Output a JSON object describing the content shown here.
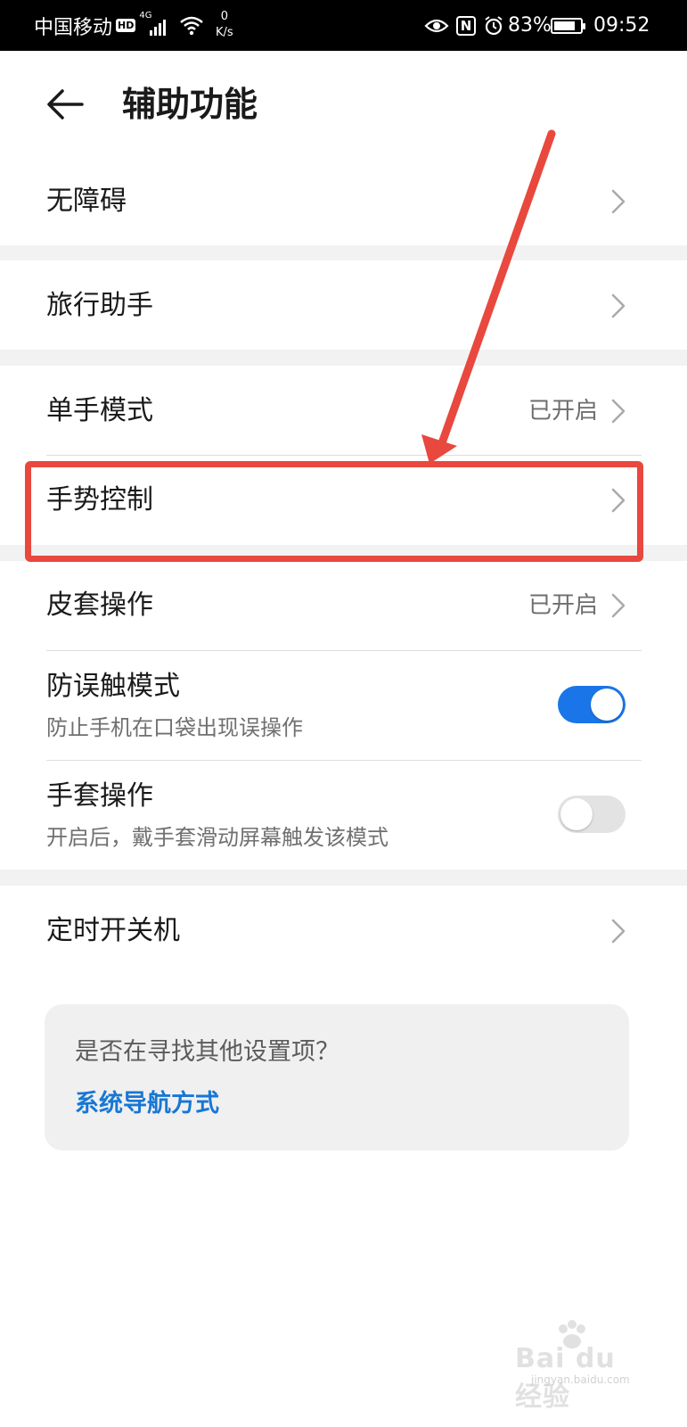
{
  "status_bar": {
    "carrier": "中国移动",
    "hd": "HD",
    "network": "4G",
    "speed_value": "0",
    "speed_unit": "K/s",
    "nfc": "N",
    "battery": "83%",
    "battery_level": 0.83,
    "time": "09:52"
  },
  "header": {
    "title": "辅助功能"
  },
  "items": [
    {
      "label": "无障碍"
    },
    {
      "label": "旅行助手"
    },
    {
      "label": "单手模式",
      "value": "已开启"
    },
    {
      "label": "手势控制"
    },
    {
      "label": "皮套操作",
      "value": "已开启"
    },
    {
      "label": "防误触模式",
      "subtitle": "防止手机在口袋出现误操作",
      "toggle_on": true
    },
    {
      "label": "手套操作",
      "subtitle": "开启后，戴手套滑动屏幕触发该模式",
      "toggle_on": false
    },
    {
      "label": "定时开关机"
    }
  ],
  "tip": {
    "question": "是否在寻找其他设置项？",
    "link": "系统导航方式"
  },
  "annotation": {
    "color": "#e8483e"
  },
  "colors": {
    "accent": "#1a76e8",
    "link": "#1777d4"
  },
  "watermark": {
    "text": "Bai du 经验",
    "url": "jingyan.baidu.com"
  }
}
